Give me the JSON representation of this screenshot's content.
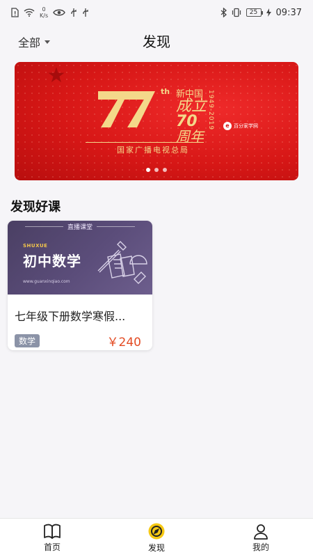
{
  "status_bar": {
    "net_speed_value": "0",
    "net_speed_unit": "K/s",
    "battery": "25",
    "time": "09:37"
  },
  "header": {
    "filter_label": "全部",
    "title": "发现"
  },
  "banner": {
    "th": "th",
    "line1": "新中国",
    "line2": "成立",
    "line3": "70",
    "line4": "周年",
    "years": "1949-2019",
    "partner_logo": "e",
    "partner": "百分家学网",
    "agency": "国家广播电视总局",
    "page_count": 3,
    "active_page": 0
  },
  "section": {
    "title": "发现好课"
  },
  "course": {
    "thumb_header": "直播课堂",
    "thumb_en": "SHUXUE",
    "thumb_title": "初中数学",
    "thumb_url": "www.guanxinqiao.com",
    "title": "七年级下册数学寒假...",
    "tag": "数学",
    "price": "￥240"
  },
  "tabbar": {
    "items": [
      {
        "label": "首页",
        "icon": "book-icon"
      },
      {
        "label": "发现",
        "icon": "discover-icon"
      },
      {
        "label": "我的",
        "icon": "person-icon"
      }
    ],
    "active_index": 1
  },
  "colors": {
    "banner_red": "#d71716",
    "gold": "#f4d88a",
    "price": "#e34b23",
    "tag_bg": "#8b93a7",
    "discover_yellow": "#f6c814"
  }
}
